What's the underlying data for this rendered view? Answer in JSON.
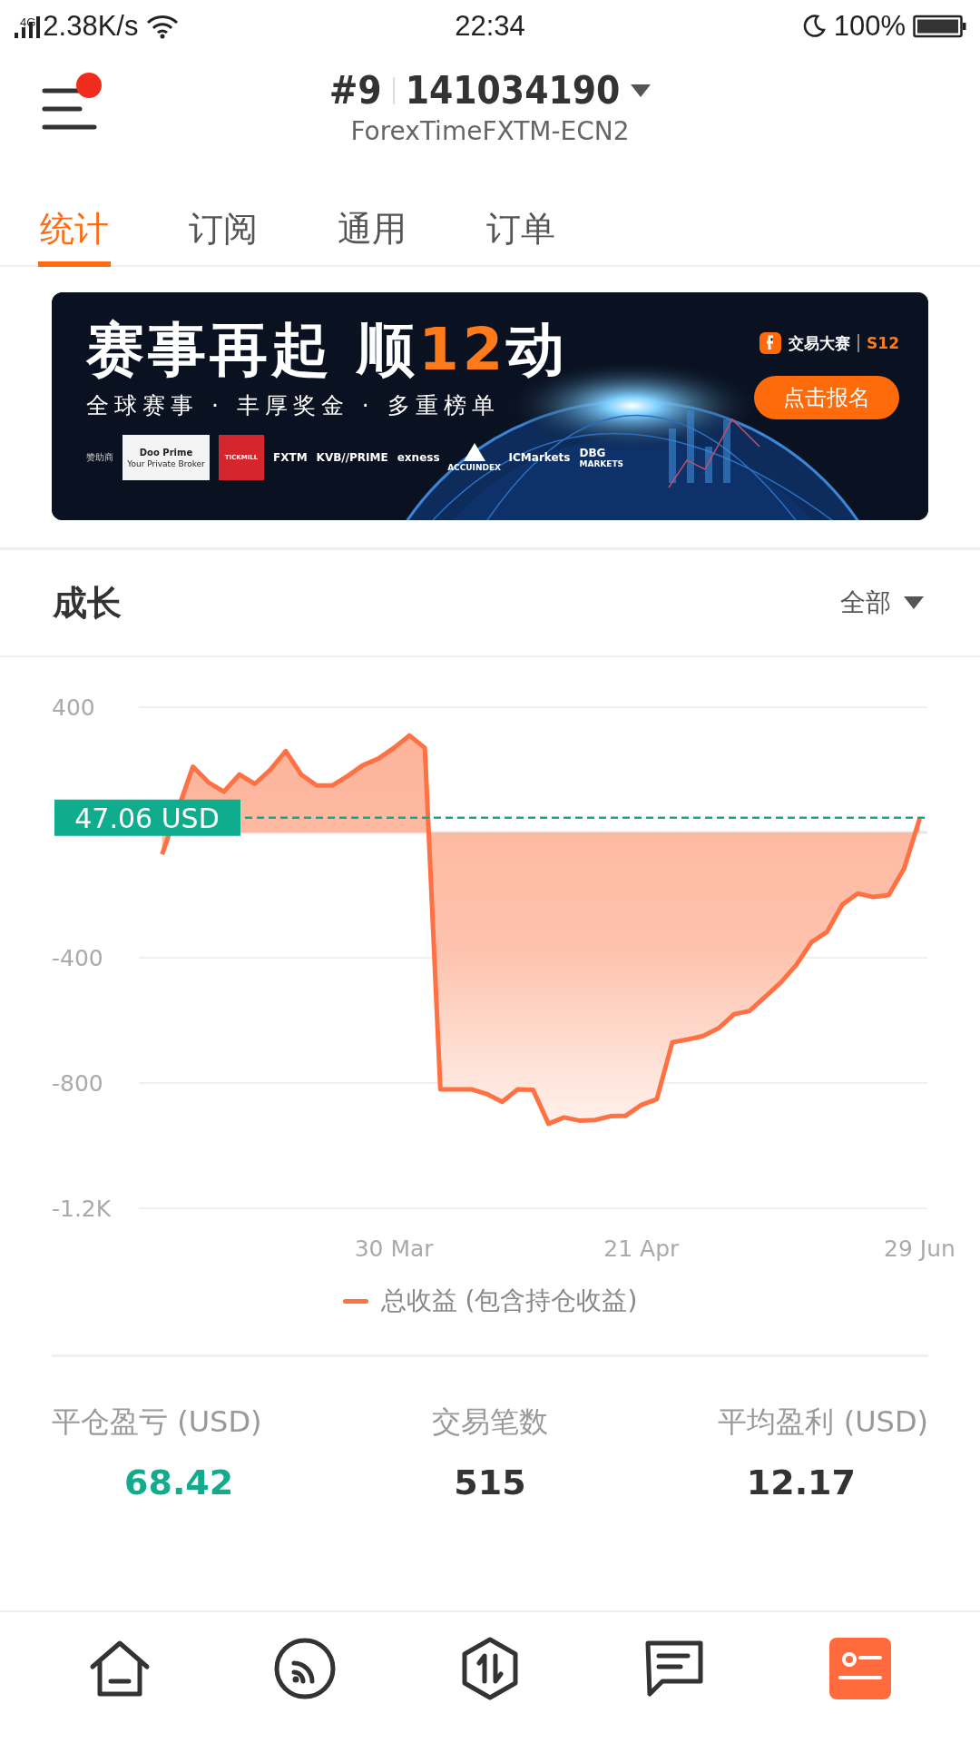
{
  "status_bar": {
    "network": "4G",
    "speed": "2.38K/s",
    "time": "22:34",
    "battery": "100%"
  },
  "header": {
    "notification": true,
    "rank": "#9",
    "account": "141034190",
    "server": "ForexTimeFXTM-ECN2"
  },
  "tabs": [
    {
      "label": "统计",
      "selected": true
    },
    {
      "label": "订阅",
      "selected": false
    },
    {
      "label": "通用",
      "selected": false
    },
    {
      "label": "订单",
      "selected": false
    }
  ],
  "banner": {
    "headline": [
      {
        "text": "赛事再起 顺",
        "highlight": false
      },
      {
        "text": "12",
        "highlight": true
      },
      {
        "text": "动",
        "highlight": false
      }
    ],
    "subtitle": "全球赛事 · 丰厚奖金 · 多重榜单",
    "brand": "交易大赛",
    "season": "S12",
    "button": "点击报名",
    "sponsor_label": "赞助商",
    "sponsors": [
      {
        "name": "Doo Prime",
        "tagline": "Your Private Broker",
        "kind": "light-tile"
      },
      {
        "name": "TICKMILL",
        "kind": "red-tile"
      },
      {
        "name": "FXTM",
        "kind": "text"
      },
      {
        "name": "KVB//PRIME",
        "kind": "text"
      },
      {
        "name": "exness",
        "kind": "text"
      },
      {
        "name": "ACCUINDEX",
        "kind": "mark"
      },
      {
        "name": "ICMarkets",
        "kind": "text"
      },
      {
        "name": "DBG",
        "tagline": "MARKETS",
        "kind": "text"
      }
    ]
  },
  "growth": {
    "title": "成长",
    "filter": "全部",
    "chart_data": {
      "type": "area",
      "categories": [
        null,
        null,
        null,
        null,
        null,
        null,
        null,
        null,
        null,
        null,
        null,
        null,
        null,
        null,
        null,
        null,
        "30 Mar",
        null,
        null,
        null,
        null,
        null,
        null,
        null,
        null,
        null,
        null,
        null,
        null,
        null,
        null,
        null,
        "21 Apr",
        null,
        null,
        null,
        null,
        null,
        null,
        null,
        null,
        null,
        null,
        null,
        null,
        null,
        null,
        null,
        null,
        null,
        "29 Jun"
      ],
      "series": [
        {
          "name": "总收益 (包含持仓收益)",
          "color": "#ff7043",
          "values": [
            null,
            -70,
            null,
            210,
            160,
            130,
            185,
            155,
            200,
            260,
            185,
            150,
            150,
            180,
            215,
            236,
            270,
            310,
            270,
            -820,
            -820,
            -820,
            -835,
            -860,
            -820,
            -822,
            -930,
            -910,
            -920,
            -918,
            -906,
            -904,
            -870,
            -852,
            -670,
            -661,
            -650,
            -625,
            -580,
            -570,
            -525,
            -480,
            -424,
            -350,
            -318,
            -230,
            -195,
            -206,
            -200,
            -115,
            44
          ]
        }
      ],
      "ylim": [
        -1200,
        400
      ],
      "yticks": [
        400,
        -400,
        -800,
        {
          "value": -1200,
          "label": "-1.2K"
        }
      ],
      "ref_lines": [
        {
          "axis": "y",
          "value": 47.06,
          "label": "47.06 USD"
        }
      ]
    }
  },
  "stats": [
    {
      "label": "平仓盈亏 (USD)",
      "value": "68.42",
      "color": "#13ab8c"
    },
    {
      "label": "交易笔数",
      "value": "515",
      "color": "#333333"
    },
    {
      "label": "平均盈利 (USD)",
      "value": "12.17",
      "color": "#333333"
    }
  ],
  "bottom_nav": [
    {
      "selected": false
    },
    {
      "selected": false
    },
    {
      "selected": false
    },
    {
      "selected": false
    },
    {
      "selected": true
    }
  ]
}
